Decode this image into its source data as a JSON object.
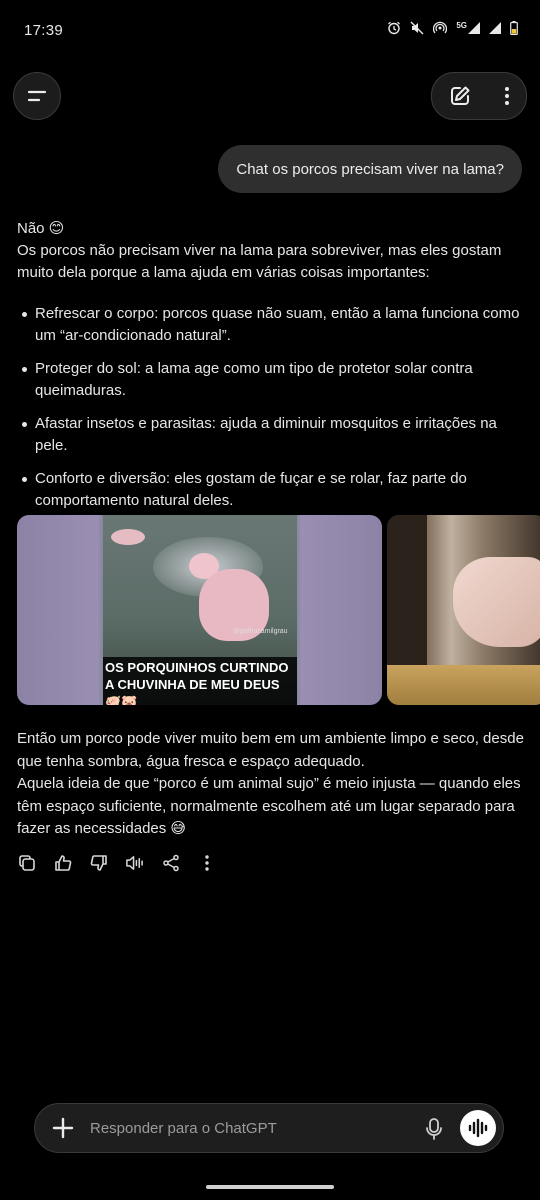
{
  "status": {
    "time": "17:39",
    "network": "5G"
  },
  "user_message": "Chat os porcos precisam viver na lama?",
  "answer": {
    "intro_line": "Não 😊",
    "intro_paragraph": "Os porcos não precisam viver na lama para sobreviver, mas eles gostam muito dela porque a lama ajuda em várias coisas importantes:",
    "bullets": [
      {
        "text": "Refrescar o corpo: porcos quase não suam, então a lama funciona como um “ar-condicionado natural”."
      },
      {
        "text": "Proteger do sol: a lama age como um tipo de protetor solar contra queimaduras."
      },
      {
        "text": "Afastar insetos e parasitas: ajuda a diminuir mosquitos e irritações na pele."
      },
      {
        "text": "Conforto e diversão: eles gostam de fuçar e se rolar, faz parte do comportamento natural deles."
      }
    ],
    "closing_paragraph_1": "Então um porco pode viver muito bem em um ambiente limpo e seco, desde que tenha sombra, água fresca e espaço adequado.",
    "closing_paragraph_2": "Aquela ideia de que “porco é um animal sujo” é meio injusta — quando eles têm espaço suficiente, normalmente escolhem até um lugar separado para fazer as necessidades 😅"
  },
  "images": {
    "video_caption": "OS PORQUINHOS CURTINDO A CHUVINHA DE MEU DEUS🐖🐷",
    "video_tag": "@palhocamilgrau"
  },
  "composer": {
    "placeholder": "Responder para o ChatGPT"
  },
  "icons": {
    "menu": "menu-icon",
    "new_chat": "edit-icon",
    "more": "more-vertical-icon",
    "copy": "copy-icon",
    "like": "thumbs-up-icon",
    "dislike": "thumbs-down-icon",
    "read_aloud": "speaker-icon",
    "share": "share-icon",
    "add": "plus-icon",
    "mic": "mic-icon",
    "voice": "voice-waveform-icon"
  }
}
